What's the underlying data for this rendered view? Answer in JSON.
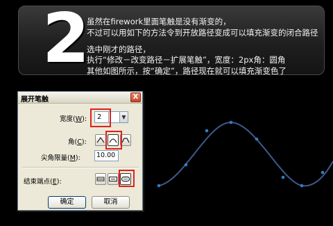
{
  "step": {
    "number": "2"
  },
  "notes": {
    "line1": "虽然在firework里面笔触是没有渐变的，",
    "line2": "不过可以用如下的方法令到开放路径变成可以填充渐变的闭合路径",
    "line3": "选中刚才的路径，",
    "line4": "执行“修改－改变路径－扩展笔触”，宽度：2px角：圆角",
    "line5": "其他如图所示，按“确定”，路径现在就可以填充渐变色了"
  },
  "dialog": {
    "title": "展开笔触",
    "close_glyph": "X",
    "width_label_prefix": "宽度(",
    "width_label_key": "W",
    "width_label_suffix": "):",
    "width_value": "2",
    "corner_label_prefix": "角(",
    "corner_label_key": "C",
    "corner_label_suffix": "):",
    "miter_label_prefix": "尖角限量(",
    "miter_label_key": "M",
    "miter_label_suffix": "):",
    "miter_value": "10.00",
    "endcap_label_prefix": "结束端点(",
    "endcap_label_key": "E",
    "endcap_label_suffix": "):",
    "ok_label": "确定",
    "cancel_label": "取消"
  },
  "colors": {
    "highlight": "#e0201a",
    "curve_stroke": "#3e5a8c",
    "curve_points": "#2f7fc1"
  },
  "icons": {
    "close": "close-icon",
    "dropdown": "chevron-down-icon",
    "corner_miter": "corner-miter-icon",
    "corner_round": "corner-round-icon",
    "corner_bevel": "corner-bevel-icon",
    "cap_butt": "cap-butt-icon",
    "cap_square": "cap-square-icon",
    "cap_round": "cap-round-icon"
  }
}
